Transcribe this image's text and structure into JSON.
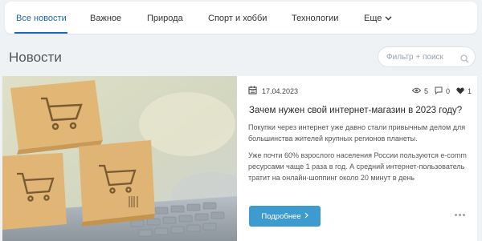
{
  "nav": {
    "tabs": [
      {
        "label": "Все новости",
        "active": true
      },
      {
        "label": "Важное"
      },
      {
        "label": "Природа"
      },
      {
        "label": "Спорт и хобби"
      },
      {
        "label": "Технологии"
      },
      {
        "label": "Еще"
      }
    ],
    "accent_color": "#2067b0"
  },
  "page": {
    "title": "Новости"
  },
  "search": {
    "placeholder": "Фильтр + поиск",
    "icon": "search-icon"
  },
  "article": {
    "date": "17.04.2023",
    "views": "5",
    "comments": "0",
    "likes": "1",
    "title": "Зачем нужен свой интернет-магазин в 2023 году?",
    "paragraph1": "Покупки через интернет уже давно стали привычным делом для большинства жителей крупных регионов планеты.",
    "paragraph2": "Уже почти 60% взрослого населения России пользуются e-comm ресурсами чаще 1 раза в год. А средний интернет-пользователь тратит на онлайн-шоппинг около 20 минут в день",
    "button_label": "Подробнее",
    "button_color": "#3d9bd0",
    "image": "cardboard-boxes-with-shopping-cart-icons-on-laptop-keyboard"
  }
}
